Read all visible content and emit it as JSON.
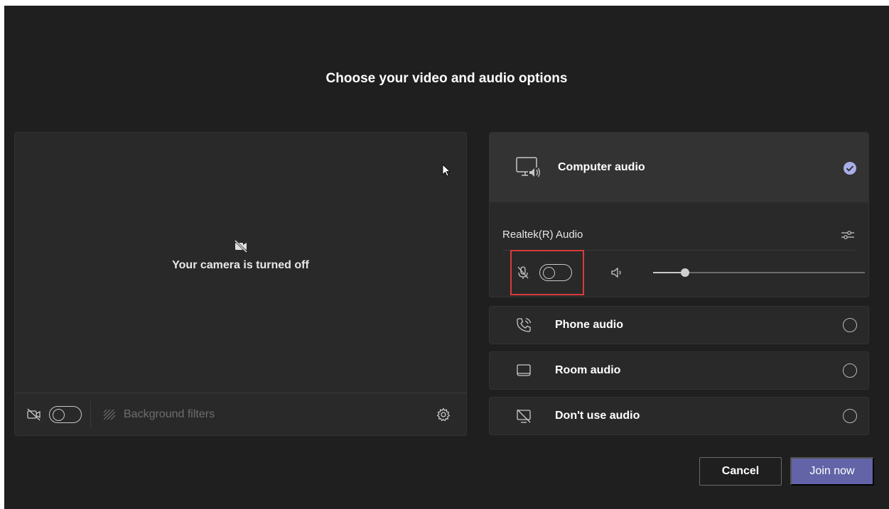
{
  "page": {
    "title": "Choose your video and audio options"
  },
  "video": {
    "camera_off_text": "Your camera is turned off",
    "camera_toggle_on": false,
    "background_filters_label": "Background filters"
  },
  "audio": {
    "computer_audio": {
      "label": "Computer audio",
      "selected": true,
      "device_name": "Realtek(R) Audio",
      "mic_toggle_on": false,
      "volume_level": 0.15
    },
    "options": [
      {
        "label": "Phone audio",
        "icon": "phone-icon",
        "selected": false
      },
      {
        "label": "Room audio",
        "icon": "room-device-icon",
        "selected": false
      },
      {
        "label": "Don't use audio",
        "icon": "no-audio-icon",
        "selected": false
      }
    ]
  },
  "actions": {
    "cancel_label": "Cancel",
    "join_label": "Join now"
  },
  "colors": {
    "background": "#1f1f1f",
    "panel": "#292929",
    "accent": "#6264a7",
    "highlight": "#d93a3a"
  }
}
